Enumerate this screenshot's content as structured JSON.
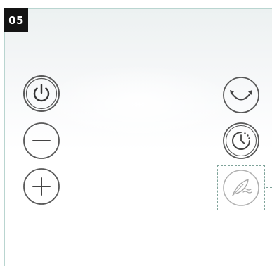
{
  "step": {
    "number": "05"
  },
  "controls": {
    "left": [
      {
        "name": "power-button",
        "icon": "power-icon"
      },
      {
        "name": "minus-button",
        "icon": "minus-icon"
      },
      {
        "name": "plus-button",
        "icon": "plus-icon"
      }
    ],
    "right": [
      {
        "name": "swing-button",
        "icon": "swing-arrows-icon"
      },
      {
        "name": "timer-button",
        "icon": "timer-clock-icon"
      },
      {
        "name": "natural-wind-button",
        "icon": "leaf-wind-icon",
        "highlighted": true
      }
    ]
  },
  "colors": {
    "button_outline": "#585858",
    "faded_outline": "#b0b0b0",
    "highlight_dash": "#7fa39a",
    "badge_bg": "#141414",
    "badge_text": "#ffffff"
  }
}
